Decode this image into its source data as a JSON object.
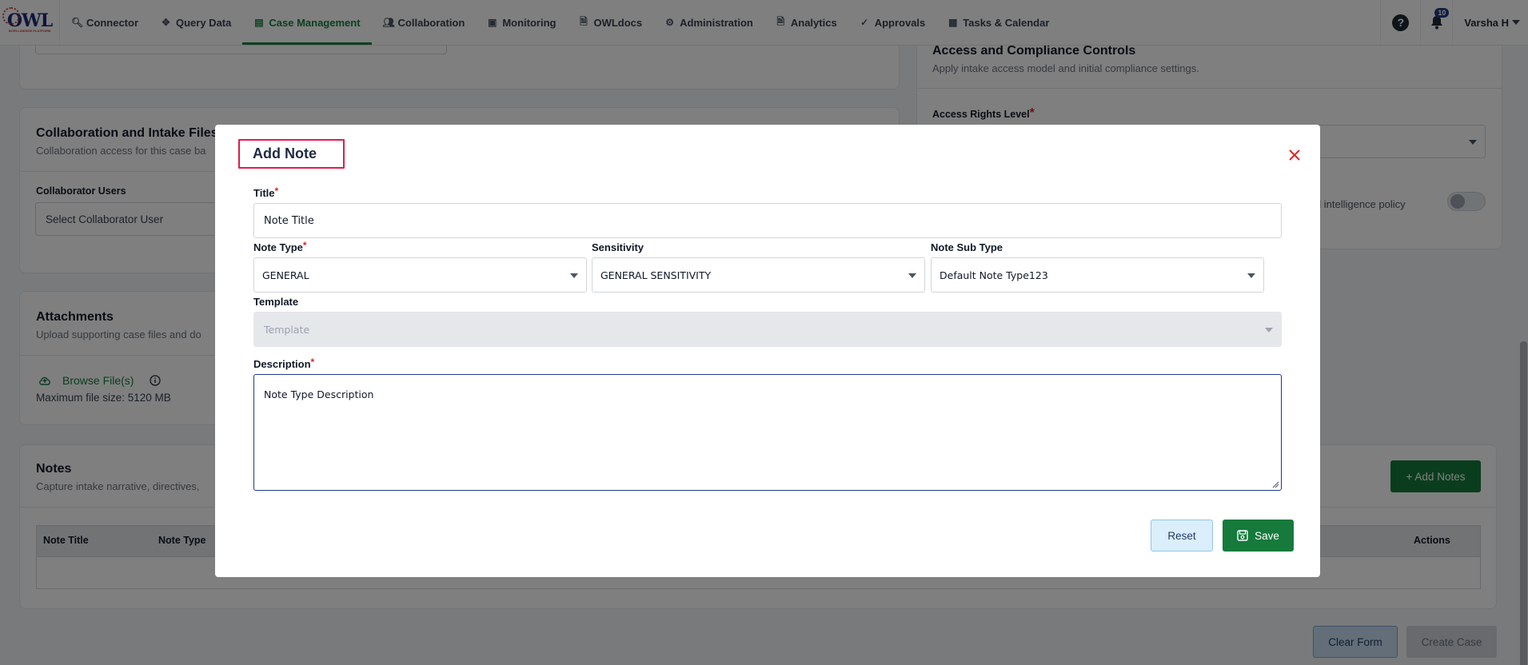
{
  "nav": {
    "logo_text": "OWL",
    "logo_sub": "INTELLIGENCE PLATFORM",
    "items": [
      {
        "label": "Connector",
        "icon": "search-icon",
        "glyph": "🔍︎"
      },
      {
        "label": "Query Data",
        "icon": "crosshair-icon",
        "glyph": "✥"
      },
      {
        "label": "Case Management",
        "icon": "document-icon",
        "glyph": "▤"
      },
      {
        "label": "Collaboration",
        "icon": "users-icon",
        "glyph": "👥︎"
      },
      {
        "label": "Monitoring",
        "icon": "monitor-icon",
        "glyph": "▣"
      },
      {
        "label": "OWLdocs",
        "icon": "file-icon",
        "glyph": "🗎︎"
      },
      {
        "label": "Administration",
        "icon": "people-gear-icon",
        "glyph": "⚙"
      },
      {
        "label": "Analytics",
        "icon": "chart-file-icon",
        "glyph": "🗎︎"
      },
      {
        "label": "Approvals",
        "icon": "approval-icon",
        "glyph": "✓"
      },
      {
        "label": "Tasks & Calendar",
        "icon": "calendar-icon",
        "glyph": "▦"
      }
    ],
    "help_glyph": "?",
    "notification_count": "10",
    "user_name": "Varsha H"
  },
  "background": {
    "access": {
      "title": "Access and Compliance Controls",
      "subtitle": "Apply intake access model and initial compliance settings.",
      "access_rights_label": "Access Rights Level",
      "policy_text": "al intelligence policy"
    },
    "collab": {
      "title": "Collaboration and Intake Files",
      "subtitle": "Collaboration access for this case ba",
      "users_label": "Collaborator Users",
      "users_placeholder": "Select Collaborator User"
    },
    "attachments": {
      "title": "Attachments",
      "subtitle": "Upload supporting case files and do",
      "browse_label": "Browse File(s)",
      "max_size": "Maximum file size: 5120 MB"
    },
    "notes": {
      "title": "Notes",
      "subtitle": "Capture intake narrative, directives,",
      "add_button": "+ Add Notes",
      "columns": [
        "Note Title",
        "Note Type",
        "Actions"
      ]
    },
    "footer": {
      "clear_button": "Clear Form",
      "create_button": "Create Case"
    }
  },
  "modal": {
    "title": "Add Note",
    "title_field": {
      "label": "Title",
      "value": "Note Title"
    },
    "note_type": {
      "label": "Note Type",
      "value": "GENERAL"
    },
    "sensitivity": {
      "label": "Sensitivity",
      "value": "GENERAL SENSITIVITY"
    },
    "note_sub_type": {
      "label": "Note Sub Type",
      "value": "Default Note Type123"
    },
    "template": {
      "label": "Template",
      "placeholder": "Template"
    },
    "description": {
      "label": "Description",
      "value": "Note Type Description"
    },
    "reset_button": "Reset",
    "save_button": "Save",
    "required_mark": "*"
  },
  "colors": {
    "accent_green": "#157a3c",
    "required_red": "#dc2626",
    "highlight_box": "#e11d48"
  }
}
